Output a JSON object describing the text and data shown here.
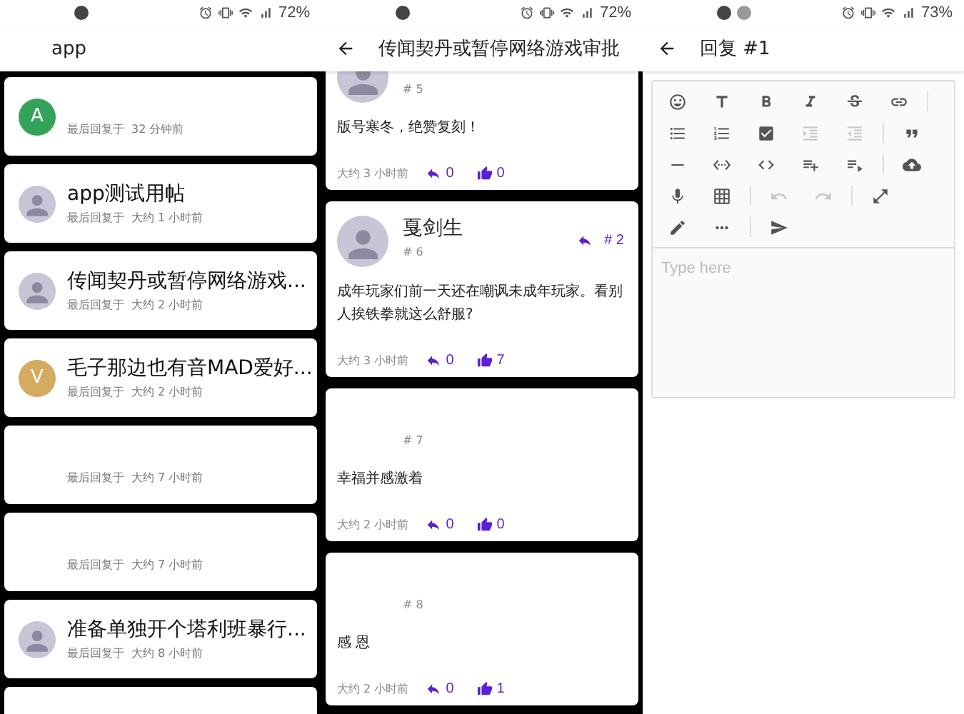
{
  "topic_list": {
    "status_bar": {
      "battery": "72%"
    },
    "title": "app",
    "topics": [
      {
        "avatar": {
          "kind": "letter",
          "letter": "A",
          "color": "#34a35a"
        },
        "meta_label": "最后回复于",
        "time": "32 分钟前"
      },
      {
        "title": "app测试用帖",
        "avatar": {
          "kind": "picture"
        },
        "meta_label": "最后回复于",
        "time": "大约 1 小时前"
      },
      {
        "title": "传闻契丹或暂停网络游戏...",
        "avatar": {
          "kind": "picture"
        },
        "meta_label": "最后回复于",
        "time": "大约 2 小时前"
      },
      {
        "title": "毛子那边也有音MAD爱好...",
        "avatar": {
          "kind": "letter",
          "letter": "V",
          "color": "#d5aa61"
        },
        "meta_label": "最后回复于",
        "time": "大约 2 小时前"
      },
      {
        "avatar": {
          "kind": "none"
        },
        "meta_label": "最后回复于",
        "time": "大约 7 小时前"
      },
      {
        "avatar": {
          "kind": "none"
        },
        "meta_label": "最后回复于",
        "time": "大约 7 小时前"
      },
      {
        "title": "准备单独开个塔利班暴行...",
        "avatar": {
          "kind": "picture"
        },
        "meta_label": "最后回复于",
        "time": "大约 8 小时前"
      },
      {
        "avatar": {
          "kind": "none"
        }
      }
    ]
  },
  "topic": {
    "status_bar": {
      "battery": "72%"
    },
    "title": "传闻契丹或暂停网络游戏审批",
    "posts": [
      {
        "clipped": true,
        "avatar": {
          "kind": "picture"
        },
        "number": "# 5",
        "body": "版号寒冬，绝赞复刻！",
        "time": "大约 3 小时前",
        "replies": "0",
        "likes": "0"
      },
      {
        "clipped": false,
        "avatar": {
          "kind": "picture"
        },
        "author": "戛剑生",
        "reply_to": "# 2",
        "number": "# 6",
        "body": "成年玩家们前一天还在嘲讽未成年玩家。看别人挨铁拳就这么舒服?",
        "time": "大约 3 小时前",
        "replies": "0",
        "likes": "7"
      },
      {
        "clipped": false,
        "avatar": {
          "kind": "none"
        },
        "number": "# 7",
        "body": "幸福并感激着",
        "time": "大约 2 小时前",
        "replies": "0",
        "likes": "0"
      },
      {
        "clipped": false,
        "avatar": {
          "kind": "none"
        },
        "number": "# 8",
        "body": "感 恩",
        "time": "大约 2 小时前",
        "replies": "0",
        "likes": "1"
      }
    ]
  },
  "reply_editor": {
    "status_bar": {
      "battery": "73%"
    },
    "title": "回复 #1",
    "toolbar_rows": [
      [
        {
          "kind": "button",
          "disabled": false
        },
        {
          "kind": "button",
          "disabled": false
        },
        {
          "kind": "button",
          "disabled": false
        },
        {
          "kind": "button",
          "disabled": false
        },
        {
          "kind": "button",
          "disabled": false
        },
        {
          "kind": "button",
          "disabled": false
        },
        {
          "kind": "separator"
        }
      ],
      [
        {
          "kind": "button",
          "disabled": false
        },
        {
          "kind": "button",
          "disabled": false
        },
        {
          "kind": "button",
          "disabled": false
        },
        {
          "kind": "button",
          "disabled": true
        },
        {
          "kind": "button",
          "disabled": true
        },
        {
          "kind": "separator"
        },
        {
          "kind": "button",
          "disabled": false
        }
      ],
      [
        {
          "kind": "button",
          "disabled": false
        },
        {
          "kind": "button",
          "disabled": false
        },
        {
          "kind": "button",
          "disabled": false
        },
        {
          "kind": "button",
          "disabled": false
        },
        {
          "kind": "button",
          "disabled": false
        },
        {
          "kind": "separator"
        },
        {
          "kind": "button",
          "disabled": false
        }
      ],
      [
        {
          "kind": "button",
          "disabled": false
        },
        {
          "kind": "button",
          "disabled": false
        },
        {
          "kind": "separator"
        },
        {
          "kind": "button",
          "disabled": true
        },
        {
          "kind": "button",
          "disabled": true
        },
        {
          "kind": "separator"
        },
        {
          "kind": "button",
          "disabled": false
        }
      ],
      [
        {
          "kind": "button",
          "disabled": false
        },
        {
          "kind": "button",
          "disabled": false
        },
        {
          "kind": "separator"
        },
        {
          "kind": "button",
          "disabled": false
        }
      ]
    ],
    "placeholder": "Type here"
  }
}
